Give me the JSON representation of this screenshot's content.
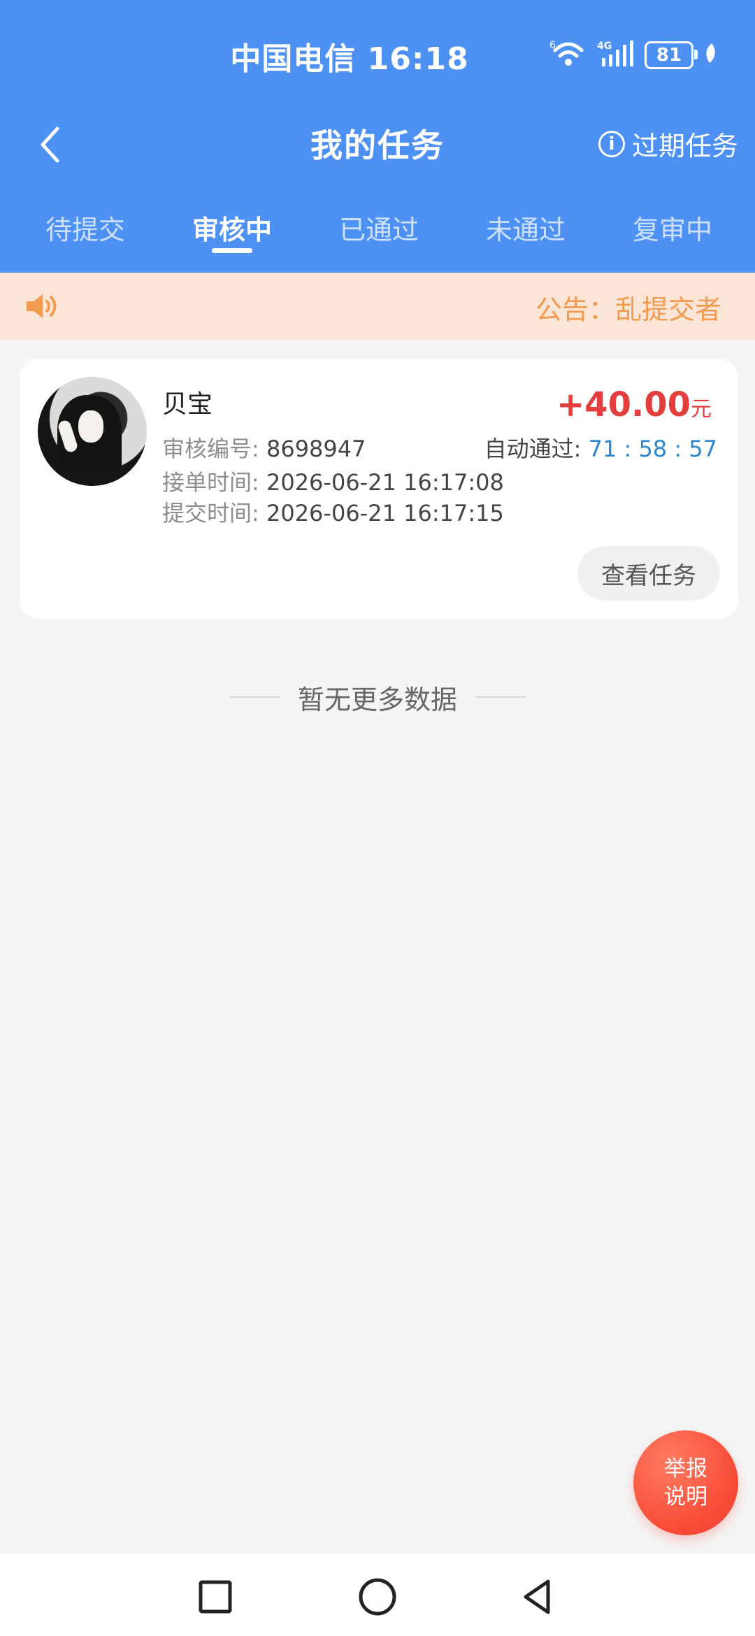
{
  "status_bar": {
    "carrier_time": "中国电信 16:18",
    "wifi_label": "6",
    "network_label": "4G",
    "battery": "81"
  },
  "header": {
    "title": "我的任务",
    "expired_label": "过期任务"
  },
  "tabs": [
    {
      "label": "待提交",
      "active": false
    },
    {
      "label": "审核中",
      "active": true
    },
    {
      "label": "已通过",
      "active": false
    },
    {
      "label": "未通过",
      "active": false
    },
    {
      "label": "复审中",
      "active": false
    }
  ],
  "notice": {
    "text": "公告：乱提交者"
  },
  "task": {
    "name": "贝宝",
    "amount": "+40.00",
    "unit": "元",
    "review_no_label": "审核编号:",
    "review_no": "8698947",
    "auto_pass_label": "自动通过:",
    "countdown": "71 : 58 : 57",
    "accept_time_label": "接单时间:",
    "accept_time": "2026-06-21 16:17:08",
    "submit_time_label": "提交时间:",
    "submit_time": "2026-06-21 16:17:15",
    "view_button": "查看任务"
  },
  "empty_state": {
    "text": "暂无更多数据"
  },
  "floating": {
    "report_line1": "举报",
    "report_line2": "说明"
  },
  "colors": {
    "header": "#4d91f5",
    "notice_bg": "#fbe5d6",
    "notice_text": "#f29b4f",
    "amount": "#e33d3d",
    "countdown": "#2f86cd",
    "report": "#f84d38"
  }
}
